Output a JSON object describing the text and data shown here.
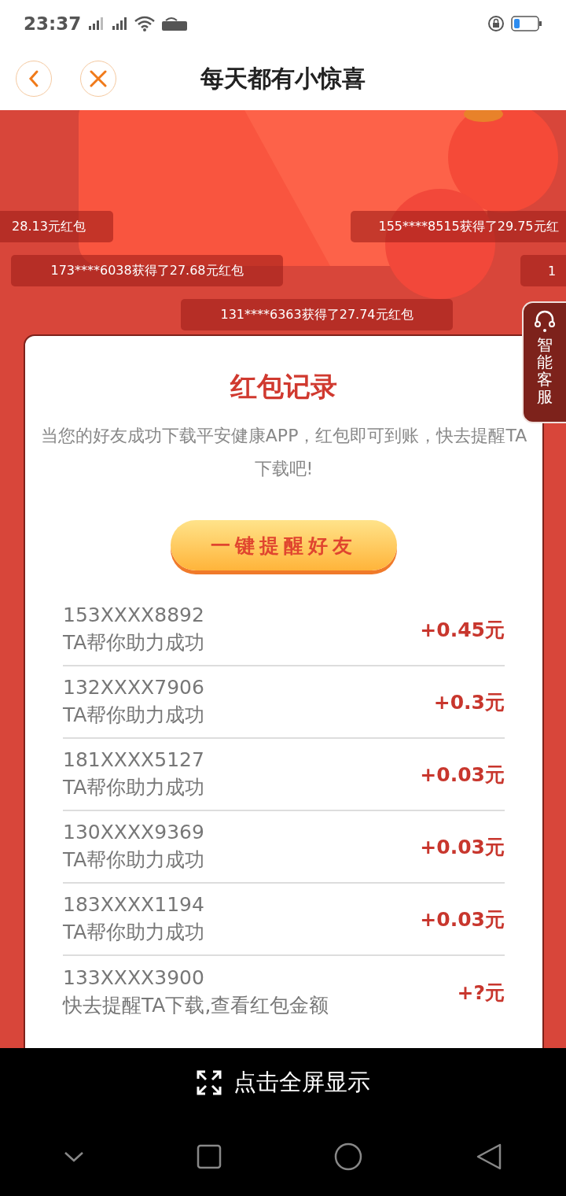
{
  "status_bar": {
    "time": "23:37"
  },
  "header": {
    "title": "每天都有小惊喜"
  },
  "barrage": [
    {
      "text": "28.13元红包"
    },
    {
      "text": "155****8515获得了29.75元红"
    },
    {
      "text": "173****6038获得了27.68元红包"
    },
    {
      "text": "1"
    },
    {
      "text": "131****6363获得了27.74元红包"
    }
  ],
  "service_tab": {
    "label": "智能客服"
  },
  "card": {
    "title": "红包记录",
    "subtitle": "当您的好友成功下载平安健康APP，红包即可到账，快去提醒TA下载吧!",
    "button": "一键提醒好友",
    "rows": [
      {
        "phone": "153XXXX8892",
        "status": "TA帮你助力成功",
        "amount": "+0.45元"
      },
      {
        "phone": "132XXXX7906",
        "status": "TA帮你助力成功",
        "amount": "+0.3元"
      },
      {
        "phone": "181XXXX5127",
        "status": "TA帮你助力成功",
        "amount": "+0.03元"
      },
      {
        "phone": "130XXXX9369",
        "status": "TA帮你助力成功",
        "amount": "+0.03元"
      },
      {
        "phone": "183XXXX1194",
        "status": "TA帮你助力成功",
        "amount": "+0.03元"
      },
      {
        "phone": "133XXXX3900",
        "status": "快去提醒TA下载,查看红包金额",
        "amount": "+?元"
      }
    ]
  },
  "fullscreen_bar": {
    "label": "点击全屏显示"
  }
}
